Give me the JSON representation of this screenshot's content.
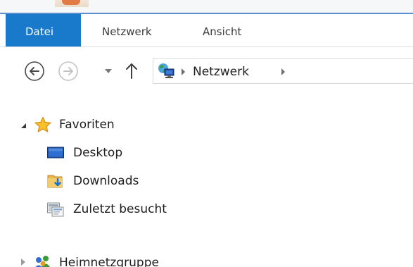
{
  "ribbon": {
    "tabs": [
      {
        "label": "Datei"
      },
      {
        "label": "Netzwerk"
      },
      {
        "label": "Ansicht"
      }
    ]
  },
  "navigation": {
    "back_icon": "back-arrow-icon",
    "forward_icon": "forward-arrow-icon",
    "recent_dropdown_icon": "chevron-down-icon",
    "up_icon": "up-arrow-icon"
  },
  "address_bar": {
    "location_icon": "network-icon",
    "crumbs": [
      "Netzwerk"
    ]
  },
  "nav_pane": {
    "favorites": {
      "label": "Favoriten",
      "icon": "star-icon",
      "items": [
        {
          "label": "Desktop",
          "icon": "desktop-icon"
        },
        {
          "label": "Downloads",
          "icon": "downloads-folder-icon"
        },
        {
          "label": "Zuletzt besucht",
          "icon": "recent-places-icon"
        }
      ]
    },
    "homegroup": {
      "label": "Heimnetzgruppe",
      "icon": "homegroup-icon"
    }
  },
  "colors": {
    "file_tab_bg": "#1979ca",
    "title_accent": "#5b8fd0"
  }
}
